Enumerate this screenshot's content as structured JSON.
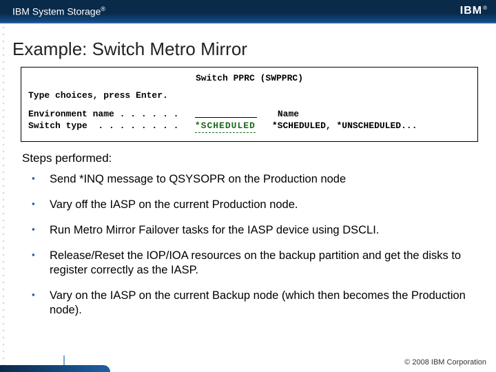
{
  "header": {
    "brand_base": "IBM System Storage",
    "brand_reg": "®",
    "logo_text": "IBM",
    "logo_reg": "®"
  },
  "title": "Example: Switch Metro Mirror",
  "terminal": {
    "title": "Switch PPRC (SWPPRC)",
    "prompt": "Type choices, press Enter.",
    "env_label": "Environment name . . . . . .   ",
    "env_hint": "Name",
    "switch_label": "Switch type  . . . . . . . .   ",
    "switch_value": "*SCHEDULED",
    "switch_options": "*SCHEDULED, *UNSCHEDULED..."
  },
  "steps_heading": "Steps performed:",
  "steps": [
    "Send *INQ message to QSYSOPR on the Production node",
    "Vary off the IASP on the current Production node.",
    "Run Metro Mirror Failover tasks for the IASP device using DSCLI.",
    "Release/Reset the IOP/IOA resources on the backup partition and get the disks to register correctly as the IASP.",
    "Vary on the IASP on the current Backup node (which then becomes the Production node)."
  ],
  "footer": {
    "copyright": "© 2008 IBM Corporation"
  }
}
